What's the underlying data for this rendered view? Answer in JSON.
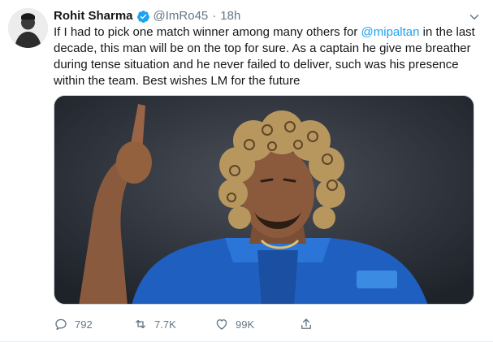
{
  "tweet": {
    "author": {
      "display_name": "Rohit Sharma",
      "handle": "@ImRo45",
      "verified": true,
      "avatar_icon": "user-avatar"
    },
    "separator": "·",
    "time": "18h",
    "text_parts": [
      "If I had to pick one match winner among many others for ",
      "@mipaltan",
      " in the last decade, this man will be on the top for sure. As a captain he give me breather during tense situation and he never failed to deliver, such was his presence within the team. Best wishes LM for the future"
    ],
    "media": {
      "icon": "photo-of-cricketer"
    },
    "actions": {
      "replies": "792",
      "retweets": "7.7K",
      "likes": "99K"
    }
  },
  "colors": {
    "text": "#14171a",
    "secondary": "#657786",
    "accent": "#1da1f2",
    "border": "#e6ecf0"
  }
}
